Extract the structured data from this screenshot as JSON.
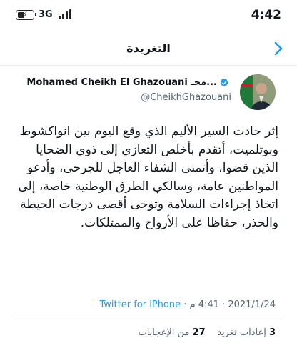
{
  "status_bar": {
    "network": "3G",
    "time": "4:42",
    "icons": [
      "battery-charging-icon",
      "signal-icon"
    ]
  },
  "header": {
    "title": "التغريدة",
    "back_icon": "chevron-icon"
  },
  "author": {
    "name": "Mohamed Cheikh El Ghazouani محـ...",
    "handle": "@CheikhGhazouani",
    "verified_icon": "verified-badge-icon",
    "verified_color": "#1d9bf0"
  },
  "tweet": {
    "text": "إثر حادث السير  الأليم الذي وقع اليوم بين انواكشوط وبوتلميت، أتقدم بأخلص التعازي إلى ذوى الضحايا الذين قضوا، وأتمنى الشفاء العاجل للجرحى، وأدعو المواطنين عامة، وسالكي الطرق الوطنية خاصة، إلى اتخاذ إجراءات السلامة وتوخى أقصى درجات الحيطة والحذر، حفاظا على الأرواح والممتلكات.",
    "date": "2021/1/24",
    "separator": "·",
    "time": "4:41 م",
    "source": "Twitter for iPhone"
  },
  "stats": {
    "retweets_count": "3",
    "retweets_label": "إعادات تغريد",
    "likes_count": "27",
    "likes_label": "من الإعجابات"
  },
  "colors": {
    "accent": "#1d9bf0",
    "text": "#0f1419",
    "muted": "#536471",
    "divider": "#e6ecf0"
  }
}
